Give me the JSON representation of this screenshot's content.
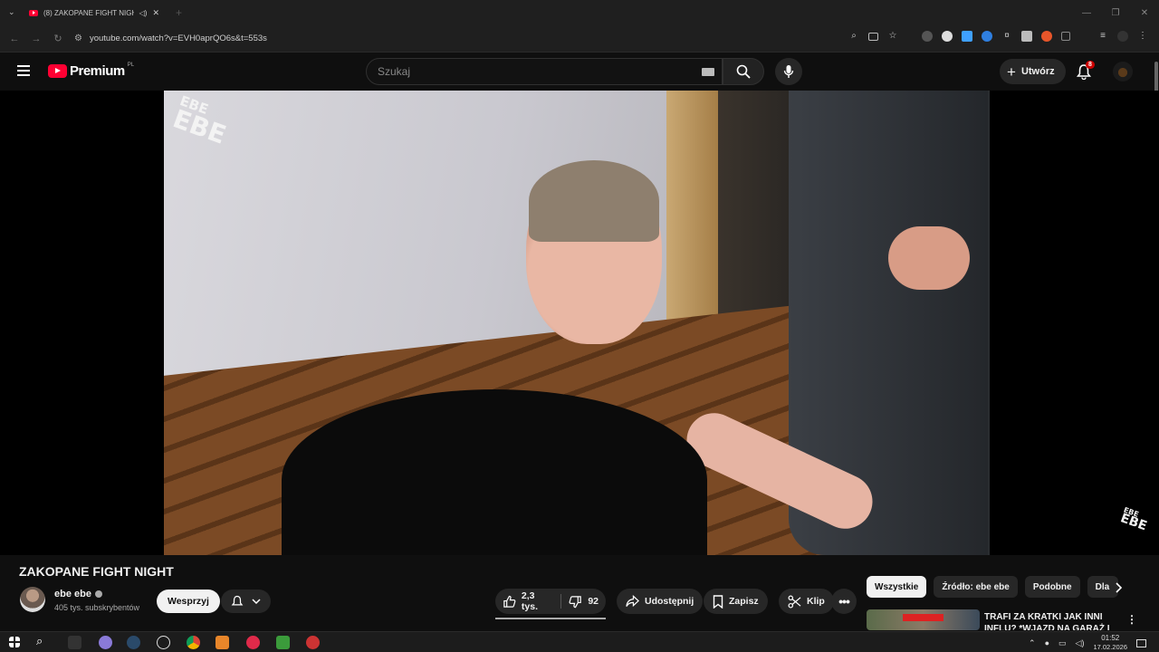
{
  "browser": {
    "tab_title": "(8) ZAKOPANE FIGHT NIGH",
    "url": "youtube.com/watch?v=EVH0aprQO6s&t=553s"
  },
  "header": {
    "logo_text": "Premium",
    "country_code": "PL",
    "search_placeholder": "Szukaj",
    "create_label": "Utwórz",
    "notifications_count": "8"
  },
  "video": {
    "title": "ZAKOPANE FIGHT NIGHT",
    "watermark_small": "EBE",
    "watermark_big": "EBE"
  },
  "channel": {
    "name": "ebe ebe",
    "subscribers": "405 tys. subskrybentów",
    "support_label": "Wesprzyj"
  },
  "actions": {
    "likes": "2,3 tys.",
    "dislikes": "92",
    "share": "Udostępnij",
    "save": "Zapisz",
    "clip": "Klip"
  },
  "chips": [
    "Wszystkie",
    "Źródło: ebe ebe",
    "Podobne",
    "Dla"
  ],
  "recommendation": {
    "title": "TRAFI ZA KRATKI JAK INNI INFLU? *WJAZD NA GARAŻ I"
  },
  "taskbar": {
    "time": "01:52",
    "date": "17.02.2026"
  },
  "colors": {
    "brand_red": "#ff0033",
    "background": "#0f0f0f",
    "pill": "#272727"
  }
}
